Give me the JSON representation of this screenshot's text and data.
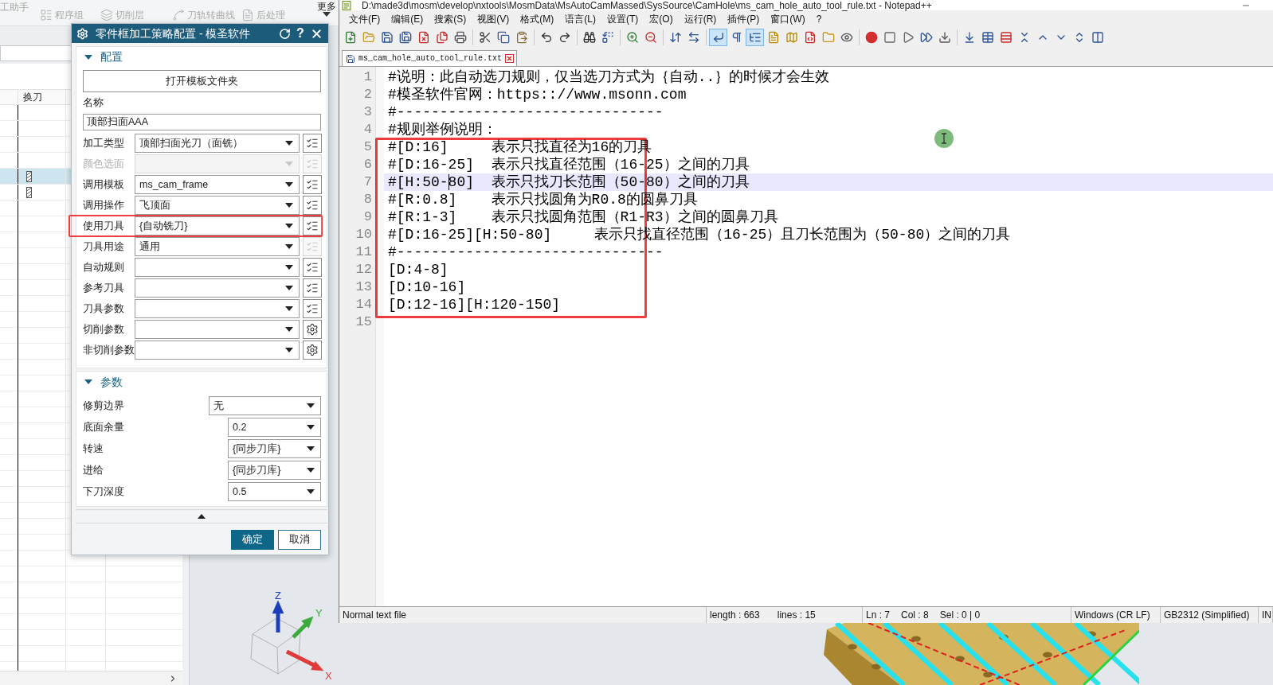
{
  "app": {
    "ribbon": {
      "cut_label": "工助手",
      "tools": [
        {
          "label": "程序组",
          "disabled": true
        },
        {
          "label": "切削层",
          "disabled": true
        },
        {
          "label": "刀轨转曲线",
          "disabled": true
        },
        {
          "label": "后处理",
          "disabled": true
        }
      ],
      "more": "更多"
    },
    "navigator": {
      "columns": [
        {
          "label": "换刀"
        }
      ],
      "rows": [
        {
          "selected": false,
          "kind": "empty"
        },
        {
          "selected": false,
          "kind": "empty"
        },
        {
          "selected": false,
          "kind": "empty"
        },
        {
          "selected": false,
          "kind": "empty"
        },
        {
          "selected": true,
          "kind": "tool"
        },
        {
          "selected": false,
          "kind": "tool"
        }
      ]
    },
    "viewport": {
      "axes": [
        {
          "label": "Z",
          "color": "#1c3fb8"
        },
        {
          "label": "Y",
          "color": "#3caa3c"
        },
        {
          "label": "X",
          "color": "#e03a3a"
        }
      ]
    }
  },
  "dialog": {
    "title": "零件框加工策略配置 - 模圣软件",
    "help": "?",
    "config": {
      "title": "配置",
      "expanded": true,
      "open_button": "打开模板文件夹",
      "name_label": "名称",
      "name_value": "顶部扫面AAA",
      "fields": [
        {
          "label": "加工类型",
          "value": "顶部扫面光刀（面铣）",
          "disabled": false,
          "kind": "list",
          "button_disabled": false,
          "highlighted": false
        },
        {
          "label": "颜色选面",
          "disabled": true,
          "kind": "list",
          "button_disabled": true,
          "highlighted": false
        },
        {
          "label": "调用模板",
          "value": "ms_cam_frame",
          "disabled": false,
          "kind": "list",
          "button_disabled": false,
          "highlighted": false
        },
        {
          "label": "调用操作",
          "value": "飞顶面",
          "disabled": false,
          "kind": "list",
          "button_disabled": false,
          "highlighted": false
        },
        {
          "label": "使用刀具",
          "value": "{自动铣刀}",
          "disabled": false,
          "kind": "list",
          "button_disabled": false,
          "highlighted": true
        },
        {
          "label": "刀具用途",
          "value": "通用",
          "disabled": false,
          "kind": "list",
          "button_disabled": true,
          "highlighted": false
        },
        {
          "label": "自动规则",
          "disabled": false,
          "kind": "list",
          "button_disabled": false,
          "highlighted": false
        },
        {
          "label": "参考刀具",
          "disabled": false,
          "kind": "list",
          "button_disabled": false,
          "highlighted": false
        },
        {
          "label": "刀具参数",
          "disabled": false,
          "kind": "list",
          "button_disabled": false,
          "highlighted": false
        },
        {
          "label": "切削参数",
          "disabled": false,
          "kind": "gear",
          "button_disabled": false,
          "highlighted": false
        },
        {
          "label": "非切削参数",
          "disabled": false,
          "kind": "gear",
          "button_disabled": false,
          "highlighted": false
        }
      ]
    },
    "params": {
      "title": "参数",
      "expanded": true,
      "fields": [
        {
          "label": "修剪边界",
          "value": "无",
          "kind": "dropdown"
        },
        {
          "label": "底面余量",
          "value": "0.2",
          "kind": "combo"
        },
        {
          "label": "转速",
          "value": "{同步刀库}",
          "kind": "combo"
        },
        {
          "label": "进给",
          "value": "{同步刀库}",
          "kind": "combo"
        },
        {
          "label": "下刀深度",
          "value": "0.5",
          "kind": "combo"
        }
      ]
    },
    "buttons": [
      {
        "label": "确定",
        "default": true
      },
      {
        "label": "取消",
        "default": false
      }
    ]
  },
  "notepad": {
    "title": "D:\\made3d\\mosm\\develop\\nxtools\\MosmData\\MsAutoCamMassed\\SysSource\\CamHole\\ms_cam_hole_auto_tool_rule.txt - Notepad++",
    "menu": [
      "文件(F)",
      "编辑(E)",
      "搜索(S)",
      "视图(V)",
      "格式(M)",
      "语言(L)",
      "设置(T)",
      "宏(O)",
      "运行(R)",
      "插件(P)",
      "窗口(W)",
      "?"
    ],
    "toolbar": [
      {
        "pressed": false
      },
      {
        "pressed": false
      },
      {
        "pressed": false
      },
      {
        "pressed": false
      },
      {
        "pressed": false
      },
      {
        "pressed": false
      },
      {
        "pressed": false
      },
      {
        "pressed": false
      },
      {
        "pressed": false
      },
      {
        "pressed": false
      },
      {
        "pressed": false
      },
      {
        "pressed": false
      },
      {
        "pressed": false
      },
      {
        "pressed": false
      },
      {
        "pressed": false
      },
      {
        "pressed": false
      },
      {
        "pressed": false
      },
      {
        "pressed": false
      },
      {
        "pressed": true
      },
      {
        "pressed": false
      },
      {
        "pressed": true
      },
      {
        "pressed": false
      },
      {
        "pressed": false
      },
      {
        "pressed": false
      },
      {
        "pressed": false
      },
      {
        "pressed": false
      },
      {
        "pressed": false
      },
      {
        "pressed": false
      },
      {
        "pressed": false
      },
      {
        "pressed": false
      },
      {
        "pressed": false
      },
      {
        "pressed": false
      },
      {
        "pressed": false
      },
      {
        "pressed": false
      },
      {
        "pressed": false
      },
      {
        "pressed": false
      },
      {
        "pressed": false
      },
      {
        "pressed": false
      },
      {
        "pressed": false
      }
    ],
    "tabs": [
      {
        "label": "ms_cam_hole_auto_tool_rule.txt",
        "selected": true
      }
    ],
    "lines": [
      {
        "number": "1",
        "text": "#说明：此自动选刀规则，仅当选刀方式为｛自动..｝的时候才会生效",
        "current": false
      },
      {
        "number": "2",
        "text": "#模圣软件官网：https:://www.msonn.com",
        "current": false
      },
      {
        "number": "3",
        "text": "#-------------------------------",
        "current": false
      },
      {
        "number": "4",
        "text": "#规则举例说明：",
        "current": false
      },
      {
        "number": "5",
        "text": "#[D:16]     表示只找直径为16的刀具",
        "current": false
      },
      {
        "number": "6",
        "text": "#[D:16-25]  表示只找直径范围（16-25）之间的刀具",
        "current": false
      },
      {
        "number": "7",
        "text": "#[H:50-80]  表示只找刀长范围（50-80）之间的刀具",
        "current": true
      },
      {
        "number": "8",
        "text": "#[R:0.8]    表示只找圆角为R0.8的圆鼻刀具",
        "current": false
      },
      {
        "number": "9",
        "text": "#[R:1-3]    表示只找圆角范围（R1-R3）之间的圆鼻刀具",
        "current": false
      },
      {
        "number": "10",
        "text": "#[D:16-25][H:50-80]     表示只找直径范围（16-25）且刀长范围为（50-80）之间的刀具",
        "current": false
      },
      {
        "number": "11",
        "text": "#-------------------------------",
        "current": false
      },
      {
        "number": "12",
        "text": "[D:4-8]",
        "current": false
      },
      {
        "number": "13",
        "text": "[D:10-16]",
        "current": false
      },
      {
        "number": "14",
        "text": "[D:12-16][H:120-150]",
        "current": false
      },
      {
        "number": "15",
        "current": false
      }
    ],
    "status_bar": [
      {
        "items": [
          "Normal text file"
        ]
      },
      {
        "items": [
          "length : 663",
          "lines : 15"
        ]
      },
      {
        "items": [
          "Ln : 7",
          "Col : 8",
          "Sel : 0 | 0"
        ]
      },
      {
        "items": [
          "Windows (CR LF)"
        ]
      },
      {
        "items": [
          "GB2312 (Simplified)"
        ]
      },
      {
        "items": [
          "IN"
        ]
      }
    ]
  }
}
